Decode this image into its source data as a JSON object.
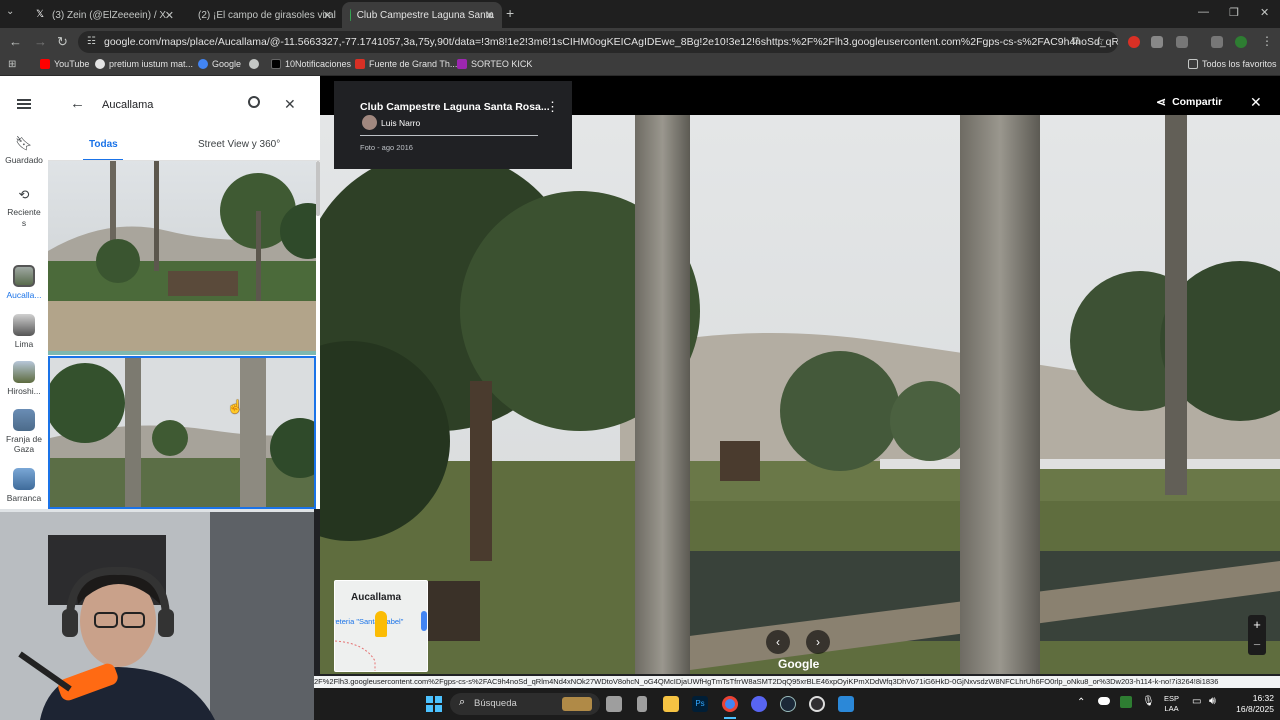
{
  "browser": {
    "tabs": [
      {
        "title": "(3) Zein (@ElZeeeein) / X",
        "icon": "x-logo-icon",
        "active": false
      },
      {
        "title": "(2) ¡El campo de girasoles viral",
        "icon": "youtube-icon",
        "active": false
      },
      {
        "title": "Club Campestre Laguna Santa",
        "icon": "maps-pin-icon",
        "active": true
      }
    ],
    "url": "google.com/maps/place/Aucallama/@-11.5663327,-77.1741057,3a,75y,90t/data=!3m8!1e2!3m6!1sCIHM0ogKEICAgIDEwe_8Bg!2e10!3e12!6shttps:%2F%2Flh3.googleusercontent.com%2Fgps-cs-s%2FAC9h4noSd_qRlm4Nd4xNOk27W...",
    "bookmarks": [
      "YouTube",
      "pretium iustum mat...",
      "Google",
      "10Notificaciones",
      "Fuente de Grand Th...",
      "SORTEO KICK"
    ],
    "bookmarks_all": "Todos los favoritos"
  },
  "maps": {
    "rail": {
      "saved_label": "Guardado",
      "recent_label": "Reciente s",
      "places": [
        "Aucalla...",
        "Lima",
        "Hiroshi...",
        "Franja de Gaza",
        "Barranca"
      ]
    },
    "search": {
      "query": "Aucallama"
    },
    "tabs": [
      {
        "label": "Todas",
        "active": true
      },
      {
        "label": "Street View y 360°",
        "active": false
      }
    ],
    "photo": {
      "title": "Club Campestre Laguna Santa Rosa...",
      "author": "Luis Narro",
      "date": "Foto - ago 2016",
      "share_label": "Compartir"
    },
    "minimap": {
      "title": "Aucallama",
      "poi": "reteria \"Santa Isabel\""
    },
    "google_label": "Google"
  },
  "status_url": "2F%2Flh3.googleusercontent.com%2Fgps-cs-s%2FAC9h4noSd_qRlm4Nd4xNOk27WDtoV8ohcN_oG4QMcIDjaUWfHgTmTsTfrrW8aSMT2DqQ95xrBLE46xpOyiKPmXDdWfq3DhVo71iG6HkD-0GjNxvsdzW8NFCLhrUh6FO0rlp_oNku8_or%3Dw203-h114-k-no!7i3264!8i1836",
  "taskbar": {
    "search_placeholder": "Búsqueda",
    "lang_top": "ESP",
    "lang_bottom": "LAA",
    "time": "16:32",
    "date": "16/8/2025"
  },
  "colors": {
    "accent": "#1a73e8",
    "tab_active": "#3c3c3c",
    "chrome_bg": "#1f1f1f"
  }
}
